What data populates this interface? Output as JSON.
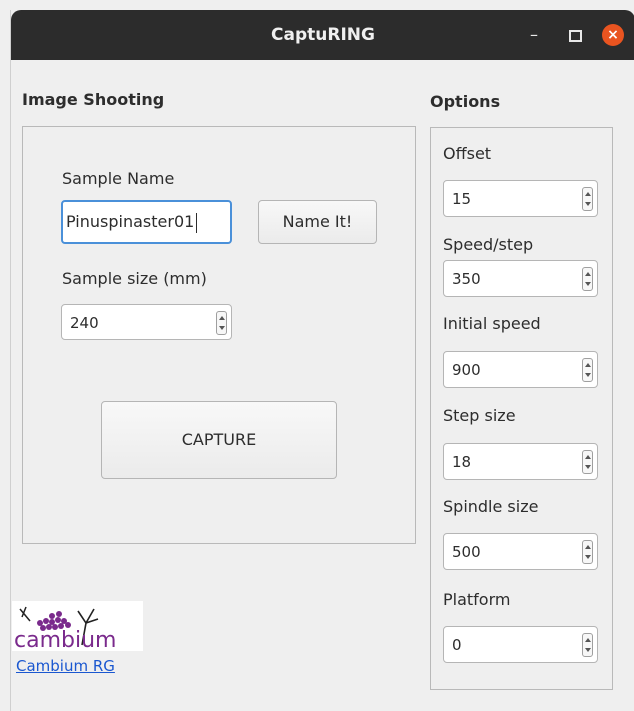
{
  "window": {
    "title": "CaptuRING"
  },
  "titlebar": {
    "minimize_glyph": "–"
  },
  "image_shooting": {
    "heading": "Image Shooting",
    "sample_name_label": "Sample Name",
    "sample_name_value": "Pinuspinaster01",
    "name_it_button": "Name It!",
    "sample_size_label": "Sample size (mm)",
    "sample_size_value": "240",
    "capture_button": "CAPTURE"
  },
  "options": {
    "heading": "Options",
    "fields": [
      {
        "label": "Offset",
        "value": "15"
      },
      {
        "label": "Speed/step",
        "value": "350"
      },
      {
        "label": "Initial speed",
        "value": "900"
      },
      {
        "label": "Step size",
        "value": "18"
      },
      {
        "label": "Spindle size",
        "value": "500"
      },
      {
        "label": "Platform",
        "value": "0"
      }
    ]
  },
  "logo": {
    "text": "cambium"
  },
  "footer": {
    "link_text": "Cambium RG"
  },
  "colors": {
    "accent": "#4a90d9",
    "close": "#e95420",
    "link": "#1a57d0",
    "logo_purple": "#7a2a8c"
  }
}
